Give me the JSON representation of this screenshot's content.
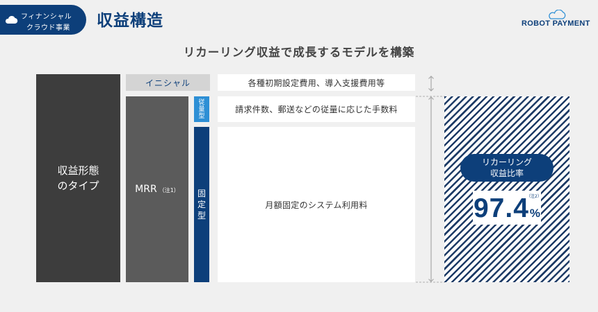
{
  "header": {
    "tag_line1": "フィナンシャル",
    "tag_line2": "クラウド事業",
    "title": "収益構造",
    "logo_text": "ROBOT PAYMENT"
  },
  "subtitle": "リカーリング収益で成長するモデルを構築",
  "diagram": {
    "revenue_type_line1": "収益形態",
    "revenue_type_line2": "のタイプ",
    "initial_label": "イニシャル",
    "mrr_label": "MRR",
    "mrr_note": "（注1）",
    "usage_label": [
      "従",
      "量",
      "型"
    ],
    "fixed_label": [
      "固",
      "定",
      "型"
    ],
    "initial_desc": "各種初期設定費用、導入支援費用等",
    "usage_desc": "請求件数、郵送などの従量に応じた手数料",
    "fixed_desc": "月額固定のシステム利用料"
  },
  "recurring": {
    "pill_line1": "リカーリング",
    "pill_line2": "収益比率",
    "value": "97.4",
    "unit": "%",
    "note": "（注2）"
  },
  "colors": {
    "navy": "#0d3f7a",
    "usage_blue": "#2d8fd5",
    "dark_gray": "#3d3d3d",
    "mid_gray": "#5b5b5b",
    "light_gray": "#d4d4d4",
    "background": "#f0f0f0"
  },
  "icons": {
    "tag_icon": "cloud-icon",
    "logo_icon": "cloud-outline-icon"
  }
}
